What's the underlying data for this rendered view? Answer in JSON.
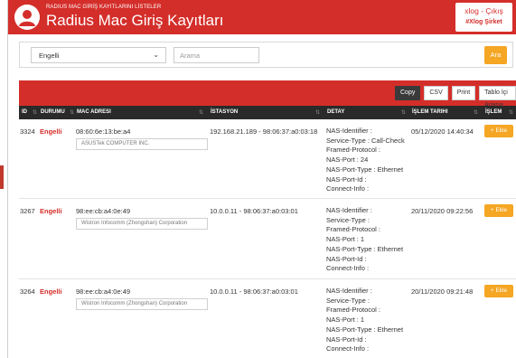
{
  "header": {
    "subtitle": "RADIUS MAC GİRİŞ KAYITLARINI LİSTELER",
    "title": "Radius Mac Giriş Kayıtları",
    "user": "xlog - Çıkış",
    "company": "#Xlog Şirket",
    "icon": "user-avatar-icon"
  },
  "filter": {
    "select_value": "Engelli",
    "search_placeholder": "Arama",
    "search_button": "Ara"
  },
  "toolbar": {
    "copy": "Copy",
    "csv": "CSV",
    "print": "Print",
    "table_search": "Tablo İçi Arama"
  },
  "table": {
    "columns": [
      "ID",
      "DURUMU",
      "MAC ADRESI",
      "İSTASYON",
      "DETAY",
      "İŞLEM TARIHI",
      "İŞLEM"
    ],
    "rows": [
      {
        "id": "3324",
        "status": "Engelli",
        "mac": "08:60:6e:13:be:a4",
        "vendor": "ASUSTek COMPUTER INC.",
        "station": "192.168.21.189 - 98:06:37:a0:03:18",
        "detail": [
          "NAS-Identifier :",
          "Service-Type : Call-Check",
          "Framed-Protocol :",
          "NAS-Port : 24",
          "NAS-Port-Type : Ethernet",
          "NAS-Port-Id :",
          "Connect-Info :"
        ],
        "date": "05/12/2020 14:40:34",
        "action": "+ Ekle"
      },
      {
        "id": "3267",
        "status": "Engelli",
        "mac": "98:ee:cb:a4:0e:49",
        "vendor": "Wistron Infocomm (Zhongshan) Corporation",
        "station": "10.0.0.11 - 98:06:37:a0:03:01",
        "detail": [
          "NAS-Identifier :",
          "Service-Type :",
          "Framed-Protocol :",
          "NAS-Port : 1",
          "NAS-Port-Type : Ethernet",
          "NAS-Port-Id :",
          "Connect-Info :"
        ],
        "date": "20/11/2020 09:22:56",
        "action": "+ Ekle"
      },
      {
        "id": "3264",
        "status": "Engelli",
        "mac": "98:ee:cb:a4:0e:49",
        "vendor": "Wistron Infocomm (Zhongshan) Corporation",
        "station": "10.0.0.11 - 98:06:37:a0:03:01",
        "detail": [
          "NAS-Identifier :",
          "Service-Type :",
          "Framed-Protocol :",
          "NAS-Port : 1",
          "NAS-Port-Type : Ethernet",
          "NAS-Port-Id :",
          "Connect-Info :"
        ],
        "date": "20/11/2020 09:21:48",
        "action": "+ Ekle"
      }
    ]
  },
  "colors": {
    "brand_red": "#d42e2a",
    "accent_orange": "#f5a623",
    "header_dark": "#2a2a2a"
  }
}
